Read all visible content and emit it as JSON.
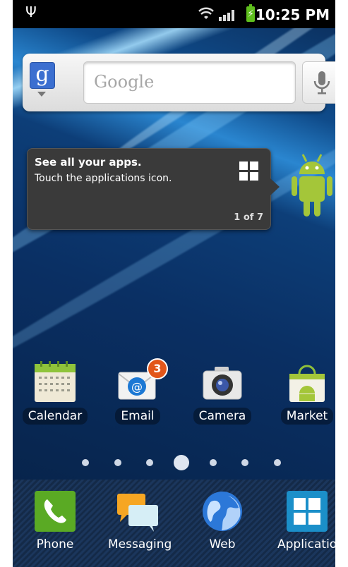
{
  "status_bar": {
    "time": "10:25 PM"
  },
  "search": {
    "placeholder": "Google",
    "logo_letter": "g"
  },
  "tip": {
    "title": "See all your apps.",
    "body": "Touch the applications icon.",
    "counter": "1 of 7"
  },
  "home_apps": [
    {
      "label": "Calendar",
      "icon": "calendar-icon"
    },
    {
      "label": "Email",
      "icon": "email-icon",
      "badge": "3"
    },
    {
      "label": "Camera",
      "icon": "camera-icon"
    },
    {
      "label": "Market",
      "icon": "market-icon"
    }
  ],
  "dock_apps": [
    {
      "label": "Phone",
      "icon": "phone-icon"
    },
    {
      "label": "Messaging",
      "icon": "messaging-icon"
    },
    {
      "label": "Web",
      "icon": "globe-icon"
    },
    {
      "label": "Applications",
      "icon": "applications-icon"
    }
  ],
  "page_indicator": {
    "count": 7,
    "current": 4
  },
  "colors": {
    "accent_green": "#5fbf1d",
    "badge_orange": "#e2561a",
    "android_green": "#a4c639"
  }
}
